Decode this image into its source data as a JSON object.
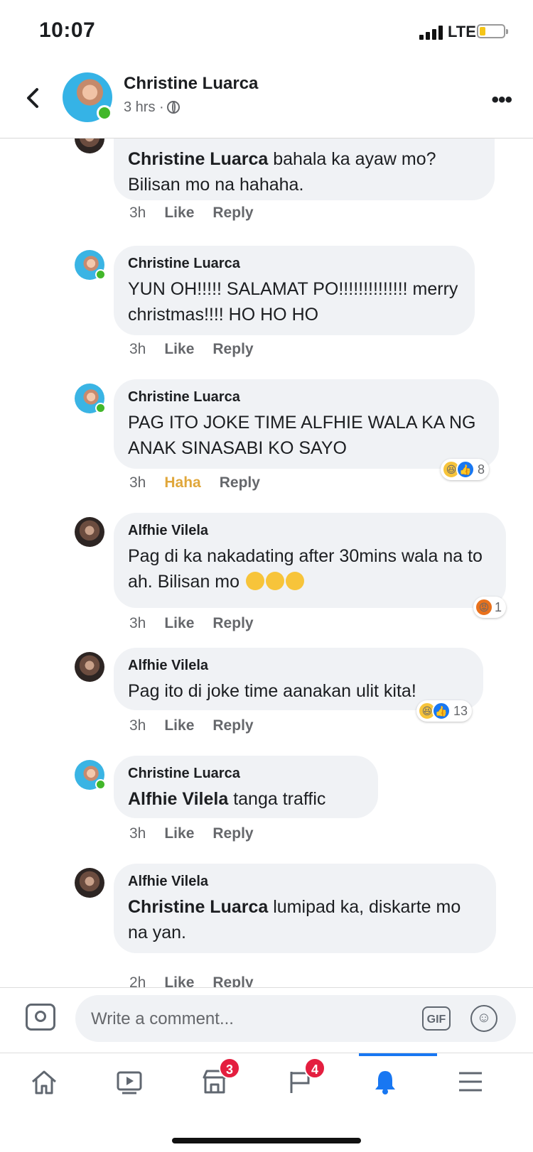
{
  "status_bar": {
    "time": "10:07",
    "network": "LTE"
  },
  "header": {
    "name": "Christine Luarca",
    "time": "3 hrs ·",
    "back_icon": "chevron-left-icon",
    "more_icon": "more-icon"
  },
  "comments": [
    {
      "author": "",
      "mention": "Christine Luarca",
      "text": " bahala ka ayaw mo? Bilisan mo na hahaha.",
      "time": "3h",
      "like": "Like",
      "reply": "Reply"
    },
    {
      "author": "Christine Luarca",
      "mention": "",
      "text": "YUN OH!!!!! SALAMAT PO!!!!!!!!!!!!!! merry christmas!!!! HO HO HO",
      "time": "3h",
      "like": "Like",
      "reply": "Reply"
    },
    {
      "author": "Christine Luarca",
      "mention": "",
      "text": "PAG ITO JOKE TIME ALFHIE WALA KA NG ANAK SINASABI KO SAYO",
      "time": "3h",
      "like": "Haha",
      "reply": "Reply",
      "reactions": "8"
    },
    {
      "author": "Alfhie Vilela",
      "mention": "",
      "text": "Pag di ka nakadating after 30mins wala na to ah. Bilisan mo",
      "time": "3h",
      "like": "Like",
      "reply": "Reply",
      "reactions": "1"
    },
    {
      "author": "Alfhie Vilela",
      "mention": "",
      "text": "Pag ito di joke time aanakan ulit kita!",
      "time": "3h",
      "like": "Like",
      "reply": "Reply",
      "reactions": "13"
    },
    {
      "author": "Christine Luarca",
      "mention": "Alfhie Vilela",
      "text": " tanga traffic",
      "time": "3h",
      "like": "Like",
      "reply": "Reply"
    },
    {
      "author": "Alfhie Vilela",
      "mention": "Christine Luarca",
      "text": " lumipad ka, diskarte mo na yan.",
      "time": "2h",
      "like": "Like",
      "reply": "Reply"
    }
  ],
  "composer": {
    "placeholder": "Write a comment...",
    "gif": "GIF"
  },
  "tabs": {
    "marketplace_badge": "3",
    "feeds_badge": "4"
  },
  "colors": {
    "accent": "#1877f2",
    "badge": "#e41e3f",
    "online": "#42b72a",
    "haha": "#e0a73b"
  }
}
